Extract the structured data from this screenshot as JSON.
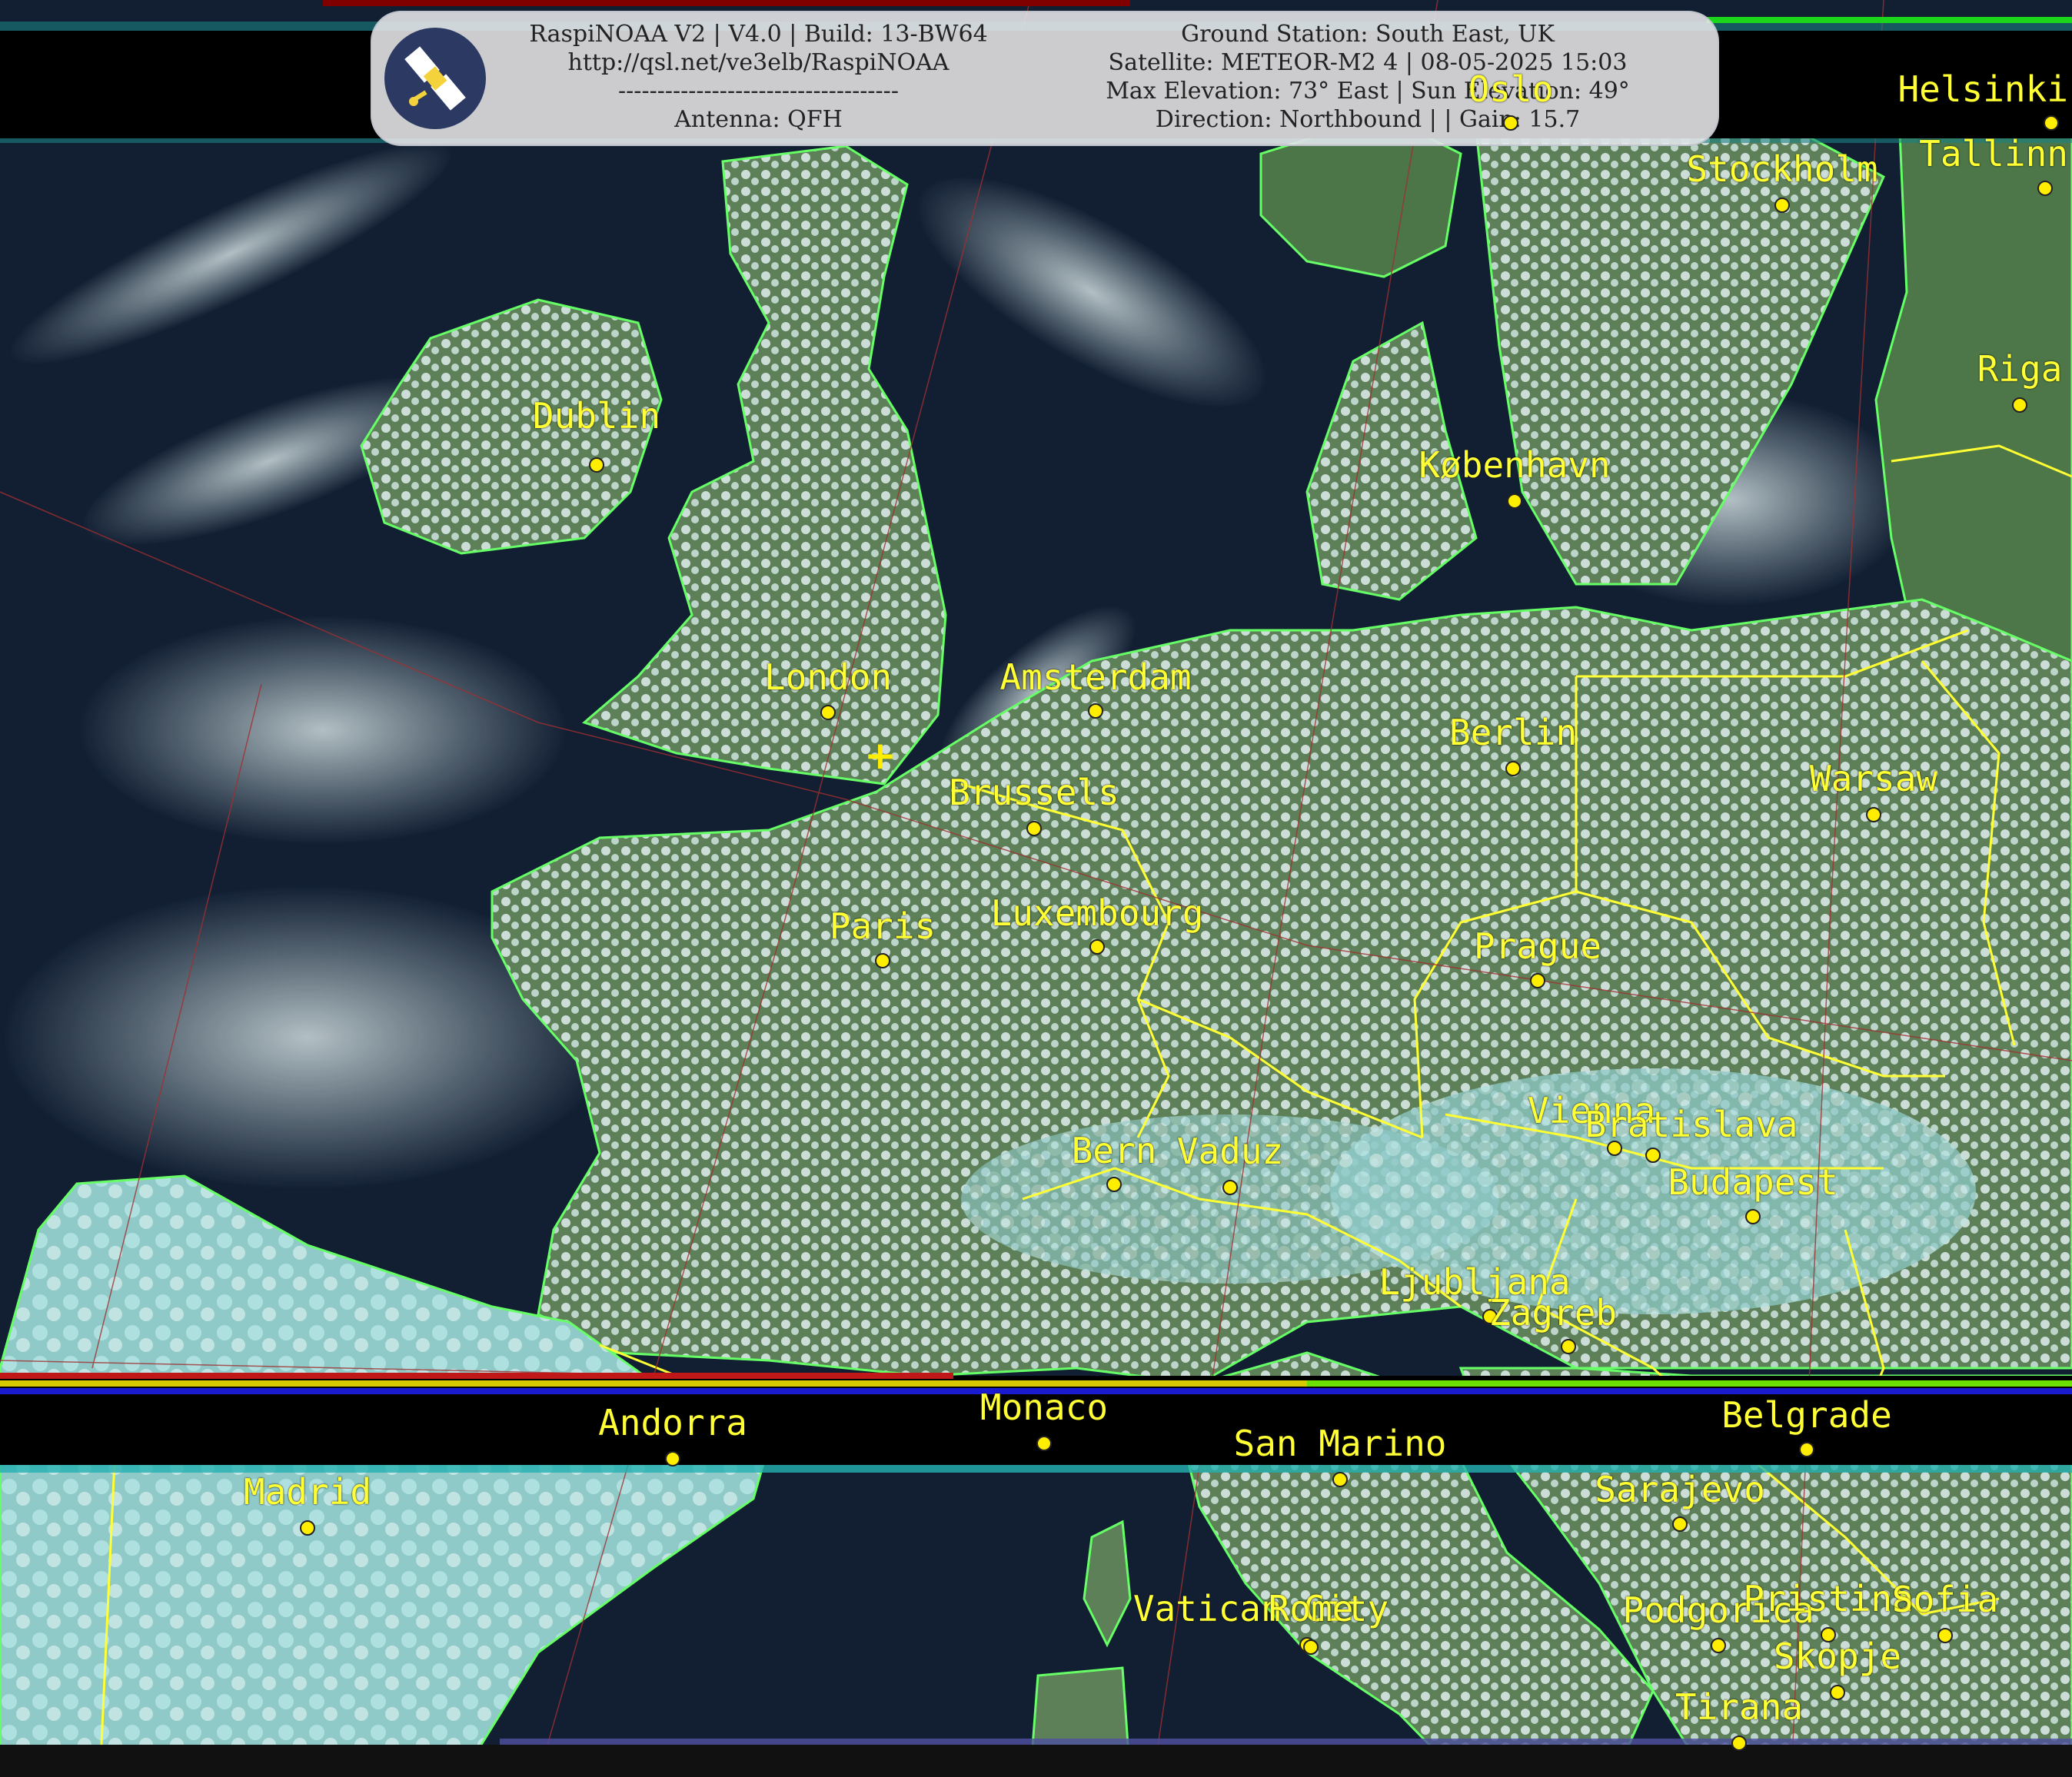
{
  "header": {
    "line1_left": "RaspiNOAA V2 | V4.0 | Build: 13-BW64",
    "line2_left": "http://qsl.net/ve3elb/RaspiNOAA",
    "line3_left": "------------------------------------",
    "line4_left": "Antenna: QFH",
    "line1_right": "Ground Station: South East, UK",
    "line2_right": "Satellite: METEOR-M2 4 | 08-05-2025 15:03",
    "line3_right": "Max Elevation: 73° East | Sun Elevation: 49°",
    "line4_right": "Direction: Northbound | | Gain: 15.7"
  },
  "colors": {
    "ocean": "#101d31",
    "land": "#4f7a4c",
    "cloud": "#cfe6e6",
    "coastline": "#66ff66",
    "border": "#ffff33",
    "gridline": "#a03030",
    "label": "#ffff33"
  },
  "station_marker": "+",
  "cities": [
    {
      "name": "Dublin"
    },
    {
      "name": "London"
    },
    {
      "name": "Amsterdam"
    },
    {
      "name": "Brussels"
    },
    {
      "name": "Paris"
    },
    {
      "name": "Luxembourg"
    },
    {
      "name": "Berlin"
    },
    {
      "name": "Prague"
    },
    {
      "name": "Warsaw"
    },
    {
      "name": "Vienna"
    },
    {
      "name": "Bratislava"
    },
    {
      "name": "Budapest"
    },
    {
      "name": "Bern"
    },
    {
      "name": "Vaduz"
    },
    {
      "name": "Ljubljana"
    },
    {
      "name": "Zagreb"
    },
    {
      "name": "Andorra"
    },
    {
      "name": "Monaco"
    },
    {
      "name": "San Marino"
    },
    {
      "name": "Madrid"
    },
    {
      "name": "Belgrade"
    },
    {
      "name": "Sarajevo"
    },
    {
      "name": "Vatican City"
    },
    {
      "name": "Rome"
    },
    {
      "name": "Podgorica"
    },
    {
      "name": "Pristina"
    },
    {
      "name": "Sofia"
    },
    {
      "name": "Skopje"
    },
    {
      "name": "Tirana"
    },
    {
      "name": "Stockholm"
    },
    {
      "name": "København"
    },
    {
      "name": "Helsinki"
    },
    {
      "name": "Tallinn"
    },
    {
      "name": "Riga"
    },
    {
      "name": "Oslo"
    }
  ]
}
